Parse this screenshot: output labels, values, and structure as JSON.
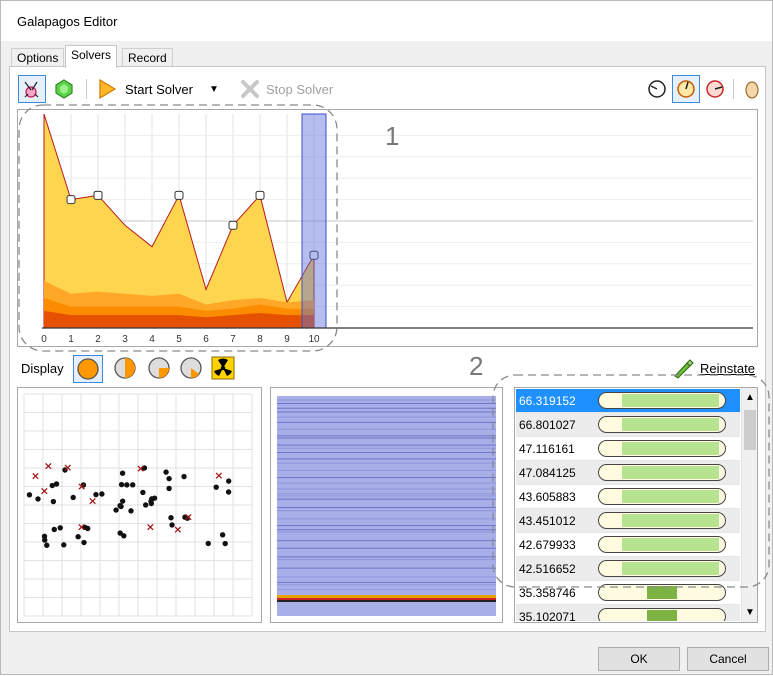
{
  "window": {
    "title": "Galapagos Editor"
  },
  "tabs": [
    {
      "label": "Options",
      "active": false
    },
    {
      "label": "Solvers",
      "active": true
    },
    {
      "label": "Record",
      "active": false
    }
  ],
  "toolbar": {
    "start_label": "Start Solver",
    "stop_label": "Stop Solver"
  },
  "annotations": {
    "one": "1",
    "two": "2"
  },
  "chart_data": {
    "type": "area",
    "categories": [
      "0",
      "1",
      "2",
      "3",
      "4",
      "5",
      "6",
      "7",
      "8",
      "9",
      "10"
    ],
    "series": [
      {
        "values": [
          100,
          60,
          62,
          48,
          38,
          62,
          18,
          48,
          62,
          12,
          34
        ]
      },
      {
        "values": [
          22,
          16,
          17,
          16,
          15,
          16,
          11,
          13,
          14,
          12,
          13
        ]
      },
      {
        "values": [
          14,
          10,
          10,
          10,
          10,
          10,
          8,
          9,
          11,
          9,
          9
        ]
      },
      {
        "values": [
          8,
          6,
          6,
          6,
          6,
          6,
          5,
          6,
          7,
          6,
          6
        ]
      }
    ],
    "ylim": [
      0,
      100
    ],
    "grid": true,
    "highlight_category": "10"
  },
  "display": {
    "label": "Display",
    "reinstate_label": "Reinstate"
  },
  "genome_list": {
    "rows": [
      {
        "value": "66.319152",
        "fill": [
          0.18,
          0.95
        ],
        "selected": true
      },
      {
        "value": "66.801027",
        "fill": [
          0.18,
          0.95
        ]
      },
      {
        "value": "47.116161",
        "fill": [
          0.18,
          0.95
        ]
      },
      {
        "value": "47.084125",
        "fill": [
          0.18,
          0.95
        ]
      },
      {
        "value": "43.605883",
        "fill": [
          0.18,
          0.95
        ]
      },
      {
        "value": "43.451012",
        "fill": [
          0.18,
          0.95
        ]
      },
      {
        "value": "42.679933",
        "fill": [
          0.18,
          0.95
        ]
      },
      {
        "value": "42.516652",
        "fill": [
          0.18,
          0.95
        ]
      },
      {
        "value": "35.358746",
        "fill": [
          0.38,
          0.62
        ],
        "dark": true
      },
      {
        "value": "35.102071",
        "fill": [
          0.38,
          0.62
        ],
        "dark": true
      }
    ]
  },
  "buttons": {
    "ok": "OK",
    "cancel": "Cancel"
  }
}
